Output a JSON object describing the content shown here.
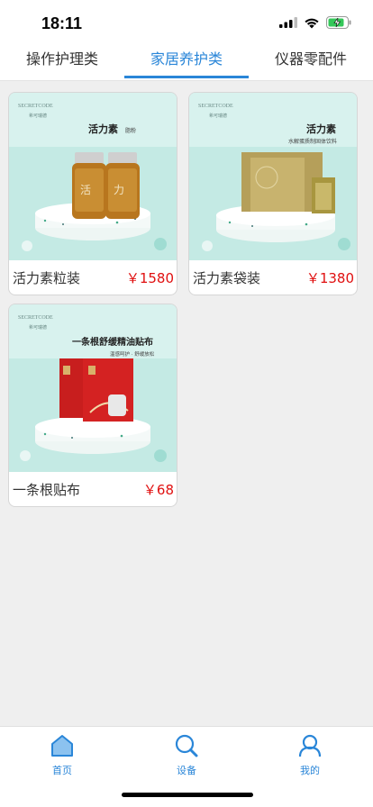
{
  "status_bar": {
    "time": "18:11"
  },
  "tabs": [
    {
      "label": "操作护理类",
      "active": false
    },
    {
      "label": "家居养护类",
      "active": true
    },
    {
      "label": "仪器零配件",
      "active": false
    }
  ],
  "products": [
    {
      "name": "活力素粒装",
      "price": "￥1580",
      "image": {
        "brand": "SECRETCODE",
        "brand_cn": "希可瑞德",
        "title": "活力素",
        "title_small": "脂粉",
        "subtitle": ""
      }
    },
    {
      "name": "活力素袋装",
      "price": "￥1380",
      "image": {
        "brand": "SECRETCODE",
        "brand_cn": "希可瑞德",
        "title": "活力素",
        "title_small": "",
        "subtitle": "水解蛋质制固体饮料"
      }
    },
    {
      "name": "一条根贴布",
      "price": "￥68",
      "image": {
        "brand": "SECRETCODE",
        "brand_cn": "希可瑞德",
        "title": "一条根舒缓精油贴布",
        "title_small": "",
        "subtitle": "温感呵护 · 舒缓放松"
      }
    }
  ],
  "bottom_nav": [
    {
      "label": "首页",
      "icon": "home-icon",
      "active": true
    },
    {
      "label": "设备",
      "icon": "search-icon",
      "active": false
    },
    {
      "label": "我的",
      "icon": "user-icon",
      "active": false
    }
  ],
  "colors": {
    "accent": "#2a86d8",
    "price": "#e01010",
    "background": "#efefef",
    "card_bg_mint": "#bfe8e2"
  }
}
